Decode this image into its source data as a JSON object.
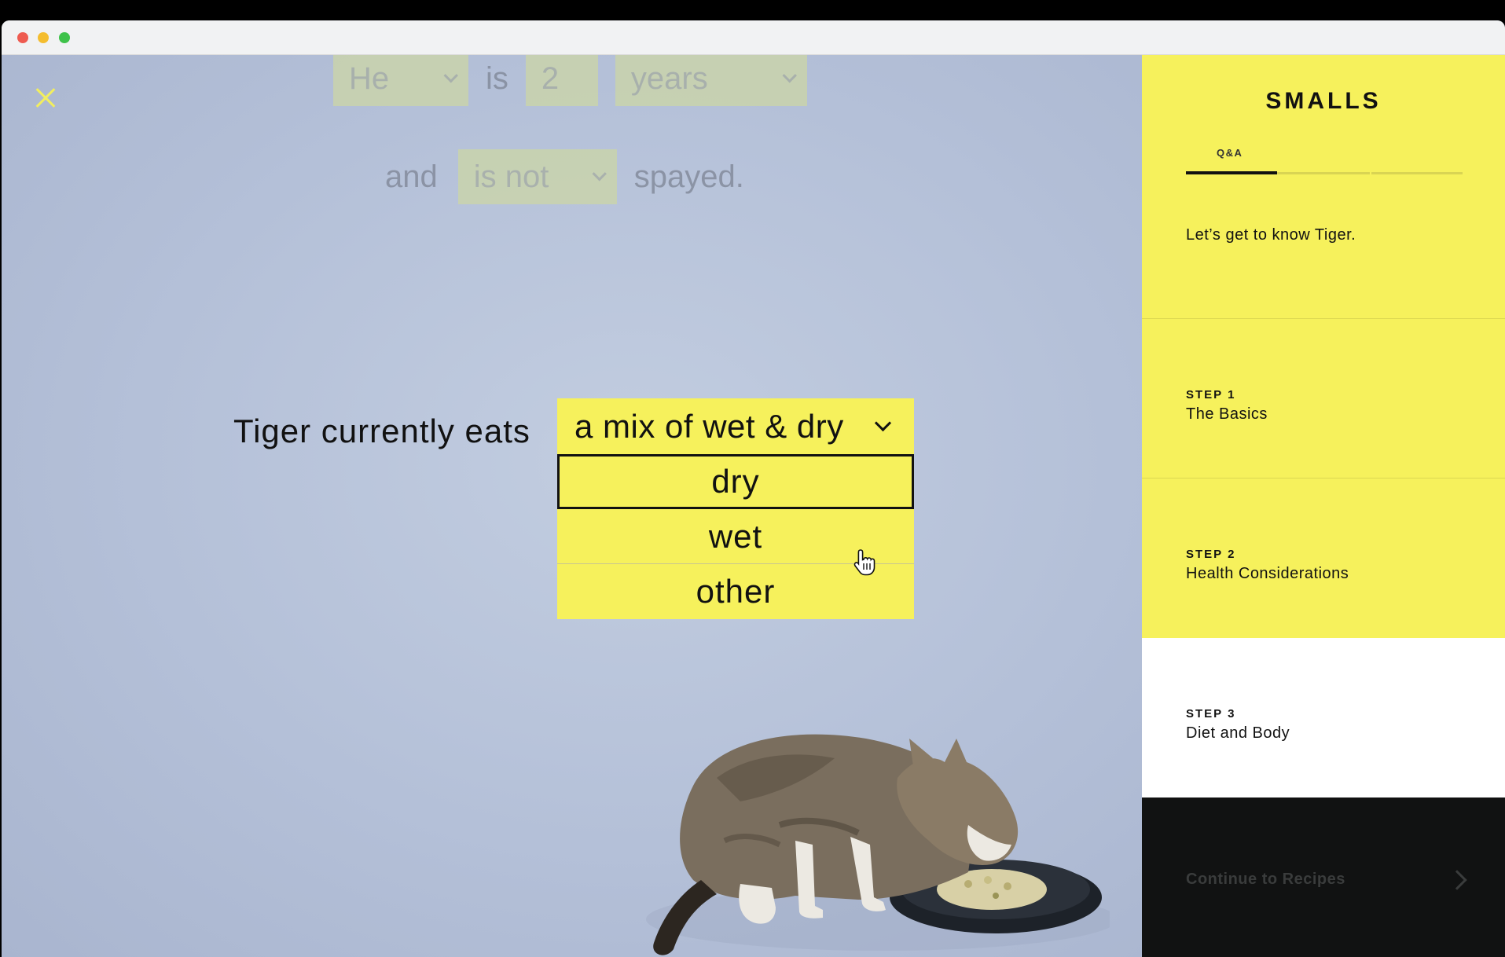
{
  "browser": {
    "traffic_lights": [
      "close",
      "minimize",
      "zoom"
    ]
  },
  "quiz": {
    "faded_row1": {
      "pronoun": "He",
      "is": "is",
      "age": "2",
      "unit": "years"
    },
    "faded_row2": {
      "and": "and",
      "status": "is not",
      "suffix": "spayed."
    },
    "question": "Tiger currently eats",
    "selected": "a mix of wet & dry",
    "options": [
      "dry",
      "wet",
      "other"
    ],
    "hovered_option": "dry"
  },
  "sidebar": {
    "logo": "SMALLS",
    "tab": "Q&A",
    "progress": 0.33,
    "intro": "Let’s get to know Tiger.",
    "steps": [
      {
        "label": "STEP 1",
        "title": "The Basics"
      },
      {
        "label": "STEP 2",
        "title": "Health Considerations"
      },
      {
        "label": "STEP 3",
        "title": "Diet and Body"
      }
    ],
    "continue_label": "Continue to Recipes"
  },
  "colors": {
    "accent_yellow": "#f6f15c",
    "background_blue": "#b7c2d9",
    "dark": "#111212"
  }
}
